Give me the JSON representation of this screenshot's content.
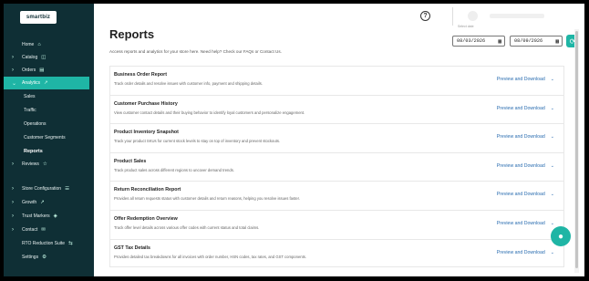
{
  "brand": {
    "logo_text": "smartbiz"
  },
  "sidebar": {
    "items": [
      {
        "label": "Home",
        "icon": "⌂",
        "has_chevron": false
      },
      {
        "label": "Catalog",
        "icon": "◫",
        "has_chevron": true
      },
      {
        "label": "Orders",
        "icon": "▤",
        "has_chevron": true
      },
      {
        "label": "Analytics",
        "icon": "↗",
        "has_chevron": true,
        "active": true
      }
    ],
    "analytics_sub": [
      {
        "label": "Sales"
      },
      {
        "label": "Traffic"
      },
      {
        "label": "Operations"
      },
      {
        "label": "Customer Segments"
      },
      {
        "label": "Reports",
        "current": true
      }
    ],
    "items_after": [
      {
        "label": "Reviews",
        "icon": "☆",
        "has_chevron": true
      }
    ],
    "bottom_items": [
      {
        "label": "Store Configuration",
        "icon": "☰",
        "has_chevron": true
      },
      {
        "label": "Growth",
        "icon": "↗",
        "has_chevron": true
      },
      {
        "label": "Trust Markers",
        "icon": "◈",
        "has_chevron": true
      },
      {
        "label": "Contact",
        "icon": "✉",
        "has_chevron": true
      },
      {
        "label": "RTO Reduction Suite",
        "icon": "⇆",
        "has_chevron": false
      },
      {
        "label": "Settings",
        "icon": "⚙",
        "has_chevron": false
      }
    ]
  },
  "header": {
    "help_icon": "?"
  },
  "main": {
    "title": "Reports",
    "description": "Access reports and analytics for your store here. Need help? Check our FAQs or Contact Us.",
    "date_label": "Select date",
    "date_from": "08/03/2026",
    "date_to": "08/09/2026"
  },
  "reports": [
    {
      "title": "Business Order Report",
      "description": "Track order details and resolve issues with customer info, payment and shipping details.",
      "action": "Preview and Download"
    },
    {
      "title": "Customer Purchase History",
      "description": "View customer contact details and their buying behavior to identify loyal customers and personalize engagement.",
      "action": "Preview and Download"
    },
    {
      "title": "Product Inventory Snapshot",
      "description": "Track your product SKUs for current stock levels to stay on top of inventory and prevent stockouts.",
      "action": "Preview and Download"
    },
    {
      "title": "Product Sales",
      "description": "Track product sales across different regions to uncover demand trends.",
      "action": "Preview and Download"
    },
    {
      "title": "Return Reconciliation Report",
      "description": "Provides all return requests status with customer details and return reasons, helping you resolve issues faster.",
      "action": "Preview and Download"
    },
    {
      "title": "Offer Redemption Overview",
      "description": "Track offer level details across various offer codes with current status and total claims.",
      "action": "Preview and Download"
    },
    {
      "title": "GST Tax Details",
      "description": "Provides detailed tax breakdowns for all invoices with order number, HSN codes, tax rates, and GST components.",
      "action": "Preview and Download"
    }
  ],
  "colors": {
    "sidebar_bg": "#0f2f35",
    "accent": "#1fb5a5",
    "link": "#2a6db0"
  }
}
